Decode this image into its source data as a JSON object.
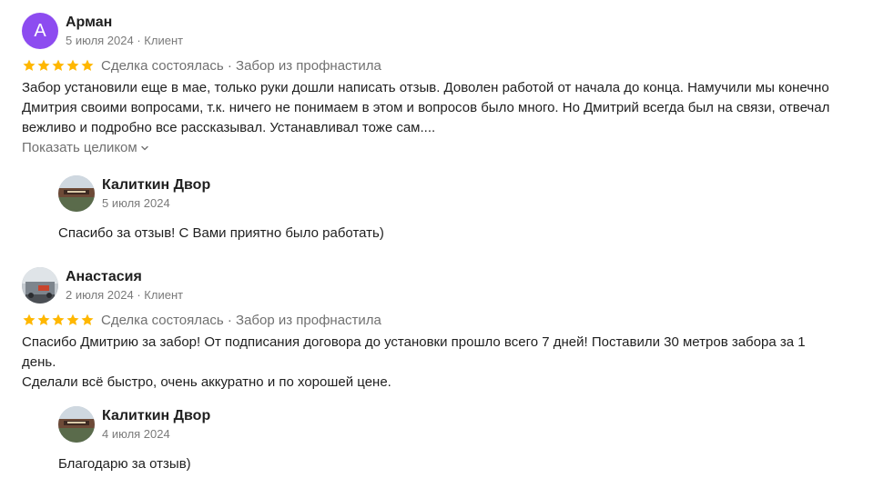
{
  "reviews": [
    {
      "author": {
        "name": "Арман",
        "avatar_letter": "А",
        "avatar_color": "#8d4cf0"
      },
      "date": "5 июля 2024",
      "role": "Клиент",
      "rating": 5,
      "deal_status": "Сделка состоялась",
      "service": "Забор из профнастила",
      "text": "Забор установили еще в мае, только руки дошли написать отзыв. Доволен работой от начала до конца. Намучили мы конечно\nДмитрия своими вопросами, т.к. ничего не понимаем в этом и вопросов было много. Но Дмитрий всегда был на связи, отвечал\nвежливо и подробно все рассказывал. Устанавливал тоже сам....",
      "show_more_label": "Показать целиком",
      "reply": {
        "author": "Калиткин Двор",
        "date": "5 июля 2024",
        "text": "Спасибо за отзыв! С Вами приятно было работать)"
      }
    },
    {
      "author": {
        "name": "Анастасия",
        "avatar_letter": "",
        "avatar_color": ""
      },
      "date": "2 июля 2024",
      "role": "Клиент",
      "rating": 5,
      "deal_status": "Сделка состоялась",
      "service": "Забор из профнастила",
      "text": "Спасибо Дмитрию за забор! От подписания договора до установки прошло всего 7 дней! Поставили 30 метров забора за 1\nдень.\nСделали всё быстро, очень аккуратно и по хорошей цене.",
      "reply": {
        "author": "Калиткин Двор",
        "date": "4 июля 2024",
        "text": "Благодарю за отзыв)"
      }
    }
  ],
  "meta_separator": " · ",
  "colors": {
    "star": "#ffb700",
    "muted_text": "#707070",
    "avatar_purple": "#8d4cf0"
  }
}
